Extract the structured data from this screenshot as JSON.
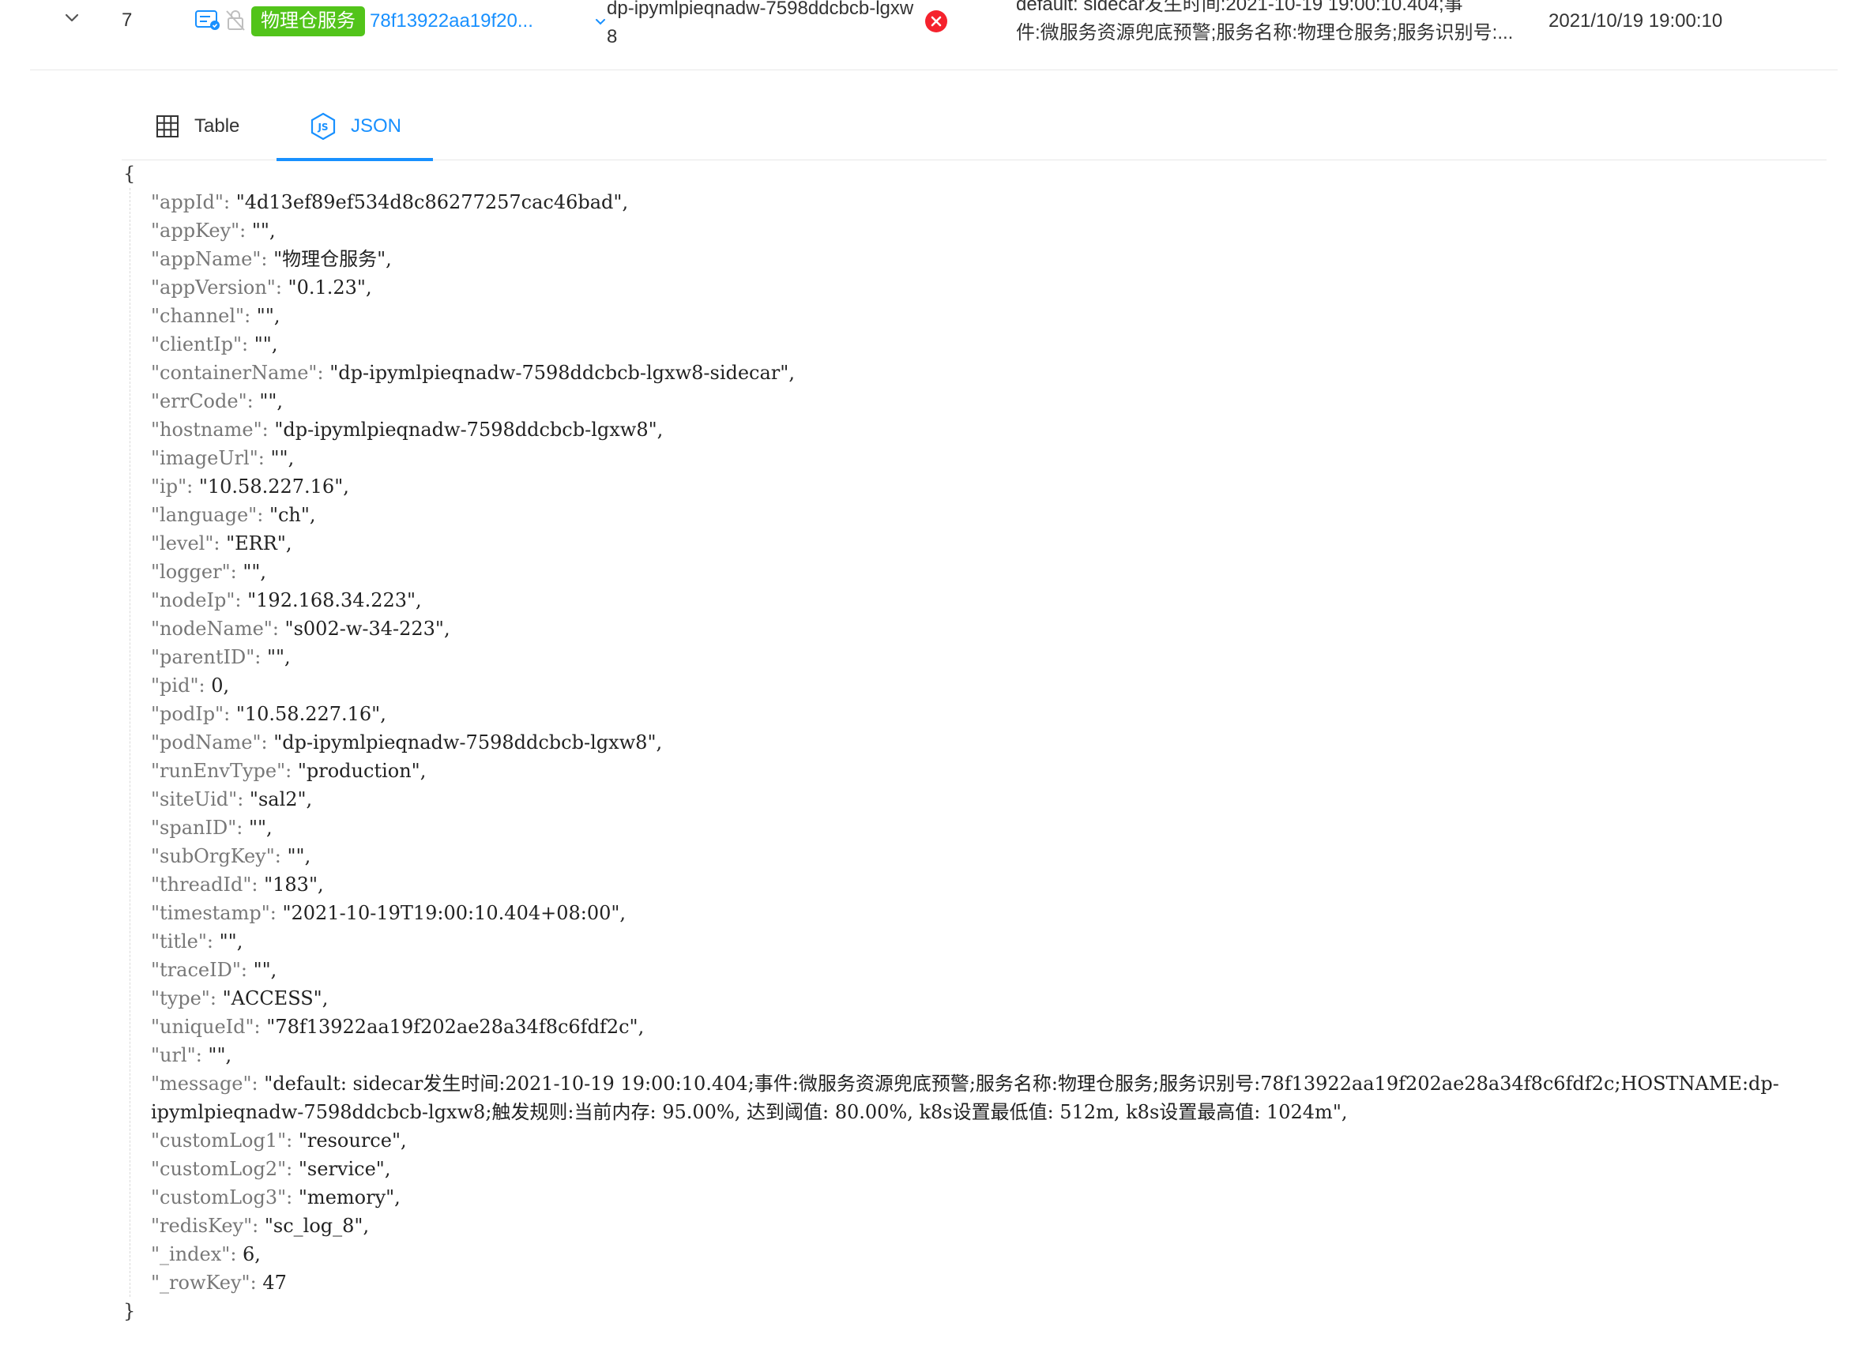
{
  "row": {
    "index": "7",
    "app_tag": "物理仓服务",
    "unique_id_short": "78f13922aa19f20...",
    "hostname": "dp-ipymlpieqnadw-7598ddcbcb-lgxw8",
    "message_line1": "default: sidecar发生时间:2021-10-19 19:00:10.404;事",
    "message_line2": "件:微服务资源兜底预警;服务名称:物理仓服务;服务识别号:...",
    "timestamp": "2021/10/19 19:00:10",
    "colors": {
      "tag_green": "#52c41a",
      "link_blue": "#1890ff",
      "error_red": "#f5222d"
    }
  },
  "tabs": {
    "table_label": "Table",
    "json_label": "JSON",
    "active": "JSON"
  },
  "json": {
    "open_brace": "{",
    "close_brace": "}",
    "entries": [
      {
        "key": "\"appId\"",
        "value": "\"4d13ef89ef534d8c86277257cac46bad\","
      },
      {
        "key": "\"appKey\"",
        "value": "\"\","
      },
      {
        "key": "\"appName\"",
        "value": "\"物理仓服务\","
      },
      {
        "key": "\"appVersion\"",
        "value": "\"0.1.23\","
      },
      {
        "key": "\"channel\"",
        "value": "\"\","
      },
      {
        "key": "\"clientIp\"",
        "value": "\"\","
      },
      {
        "key": "\"containerName\"",
        "value": "\"dp-ipymlpieqnadw-7598ddcbcb-lgxw8-sidecar\","
      },
      {
        "key": "\"errCode\"",
        "value": "\"\","
      },
      {
        "key": "\"hostname\"",
        "value": "\"dp-ipymlpieqnadw-7598ddcbcb-lgxw8\","
      },
      {
        "key": "\"imageUrl\"",
        "value": "\"\","
      },
      {
        "key": "\"ip\"",
        "value": "\"10.58.227.16\","
      },
      {
        "key": "\"language\"",
        "value": "\"ch\","
      },
      {
        "key": "\"level\"",
        "value": "\"ERR\","
      },
      {
        "key": "\"logger\"",
        "value": "\"\","
      },
      {
        "key": "\"nodeIp\"",
        "value": "\"192.168.34.223\","
      },
      {
        "key": "\"nodeName\"",
        "value": "\"s002-w-34-223\","
      },
      {
        "key": "\"parentID\"",
        "value": "\"\","
      },
      {
        "key": "\"pid\"",
        "value": "0,"
      },
      {
        "key": "\"podIp\"",
        "value": "\"10.58.227.16\","
      },
      {
        "key": "\"podName\"",
        "value": "\"dp-ipymlpieqnadw-7598ddcbcb-lgxw8\","
      },
      {
        "key": "\"runEnvType\"",
        "value": "\"production\","
      },
      {
        "key": "\"siteUid\"",
        "value": "\"sal2\","
      },
      {
        "key": "\"spanID\"",
        "value": "\"\","
      },
      {
        "key": "\"subOrgKey\"",
        "value": "\"\","
      },
      {
        "key": "\"threadId\"",
        "value": "\"183\","
      },
      {
        "key": "\"timestamp\"",
        "value": "\"2021-10-19T19:00:10.404+08:00\","
      },
      {
        "key": "\"title\"",
        "value": "\"\","
      },
      {
        "key": "\"traceID\"",
        "value": "\"\","
      },
      {
        "key": "\"type\"",
        "value": "\"ACCESS\","
      },
      {
        "key": "\"uniqueId\"",
        "value": "\"78f13922aa19f202ae28a34f8c6fdf2c\","
      },
      {
        "key": "\"url\"",
        "value": "\"\","
      },
      {
        "key": "\"message\"",
        "value": "\"default: sidecar发生时间:2021-10-19 19:00:10.404;事件:微服务资源兜底预警;服务名称:物理仓服务;服务识别号:78f13922aa19f202ae28a34f8c6fdf2c;HOSTNAME:dp-ipymlpieqnadw-7598ddcbcb-lgxw8;触发规则:当前内存: 95.00%, 达到阈值: 80.00%, k8s设置最低值: 512m, k8s设置最高值: 1024m\","
      },
      {
        "key": "\"customLog1\"",
        "value": "\"resource\","
      },
      {
        "key": "\"customLog2\"",
        "value": "\"service\","
      },
      {
        "key": "\"customLog3\"",
        "value": "\"memory\","
      },
      {
        "key": "\"redisKey\"",
        "value": "\"sc_log_8\","
      },
      {
        "key": "\"_index\"",
        "value": "6,"
      },
      {
        "key": "\"_rowKey\"",
        "value": "47"
      }
    ]
  }
}
